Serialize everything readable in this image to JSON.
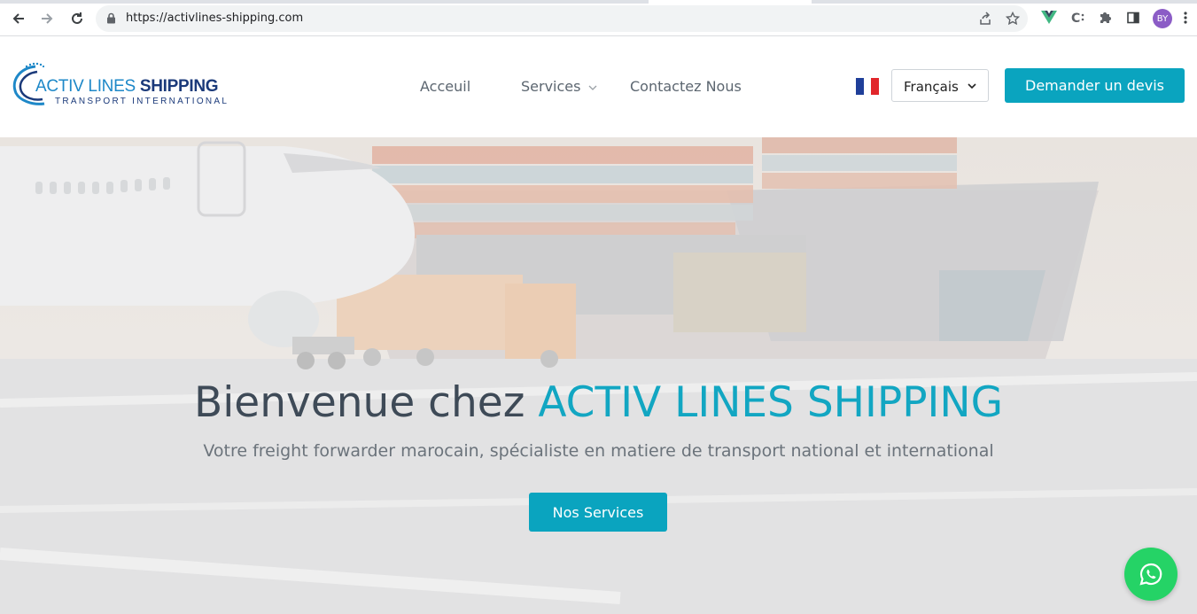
{
  "browser": {
    "url": "https://activlines-shipping.com",
    "profile_initials": "BY"
  },
  "header": {
    "logo": {
      "title_part1": "ACTIV LINES",
      "title_part2": "SHIPPING",
      "subtitle": "TRANSPORT INTERNATIONAL"
    },
    "nav": [
      {
        "label": "Acceuil"
      },
      {
        "label": "Services"
      },
      {
        "label": "Contactez Nous"
      }
    ],
    "language": {
      "selected": "Français",
      "flag_colors": [
        "#1f3f99",
        "#ffffff",
        "#e1262b"
      ]
    },
    "cta_label": "Demander un devis"
  },
  "hero": {
    "title_prefix": "Bienvenue chez",
    "title_accent": "ACTIV LINES SHIPPING",
    "subtitle": "Votre freight forwarder marocain, spécialiste en matiere de transport national et international",
    "button_label": "Nos Services"
  },
  "colors": {
    "accent": "#0aa4bf",
    "whatsapp": "#25d366"
  }
}
